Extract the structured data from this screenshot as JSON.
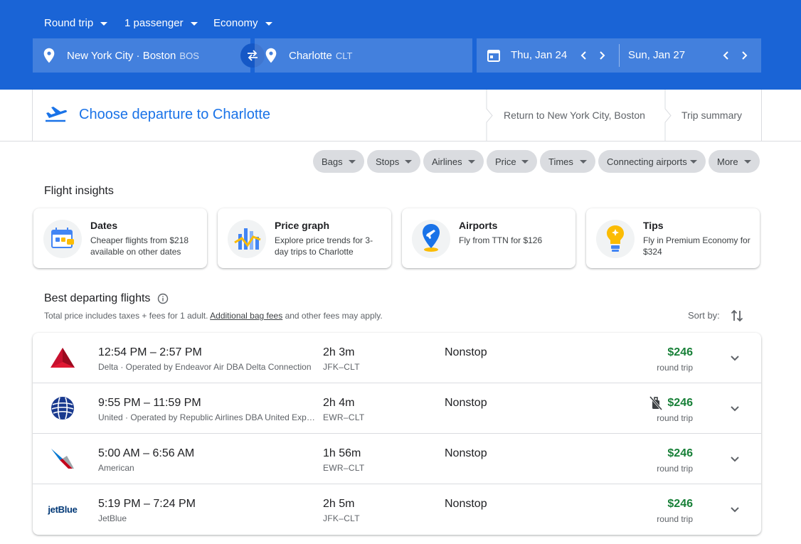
{
  "header": {
    "trip_type": "Round trip",
    "passengers": "1 passenger",
    "cabin": "Economy",
    "origin": {
      "city": "New York City · Boston",
      "code": "BOS"
    },
    "destination": {
      "city": "Charlotte",
      "code": "CLT"
    },
    "depart_date": "Thu, Jan 24",
    "return_date": "Sun, Jan 27"
  },
  "steps": {
    "current": "Choose departure to Charlotte",
    "return": "Return to New York City, Boston",
    "summary": "Trip summary"
  },
  "filters": [
    "Bags",
    "Stops",
    "Airlines",
    "Price",
    "Times",
    "Connecting airports",
    "More"
  ],
  "insights": {
    "heading": "Flight insights",
    "cards": [
      {
        "title": "Dates",
        "desc": "Cheaper flights from $218 available on other dates",
        "icon": "calendar-icon"
      },
      {
        "title": "Price graph",
        "desc": "Explore price trends for 3-day trips to Charlotte",
        "icon": "price-graph-icon"
      },
      {
        "title": "Airports",
        "desc": "Fly from TTN for $126",
        "icon": "airport-pin-icon"
      },
      {
        "title": "Tips",
        "desc": "Fly in Premium Economy for $324",
        "icon": "lightbulb-icon"
      }
    ]
  },
  "results": {
    "heading": "Best departing flights",
    "note_prefix": "Total price includes taxes + fees for 1 adult.",
    "note_link": "Additional bag fees",
    "note_suffix": "and other fees may apply.",
    "sort_label": "Sort by:"
  },
  "flights": [
    {
      "times": "12:54 PM – 2:57 PM",
      "airline": "Delta · Operated by Endeavor Air DBA Delta Connection",
      "duration": "2h 3m",
      "route": "JFK–CLT",
      "stops": "Nonstop",
      "price": "$246",
      "price_note": "round trip",
      "logo": "delta-logo"
    },
    {
      "times": "9:55 PM – 11:59 PM",
      "airline": "United · Operated by Republic Airlines DBA United Express",
      "duration": "2h 4m",
      "route": "EWR–CLT",
      "stops": "Nonstop",
      "price": "$246",
      "price_note": "round trip",
      "logo": "united-logo"
    },
    {
      "times": "5:00 AM – 6:56 AM",
      "airline": "American",
      "duration": "1h 56m",
      "route": "EWR–CLT",
      "stops": "Nonstop",
      "price": "$246",
      "price_note": "round trip",
      "logo": "american-logo"
    },
    {
      "times": "5:19 PM – 7:24 PM",
      "airline": "JetBlue",
      "duration": "2h 5m",
      "route": "JFK–CLT",
      "stops": "Nonstop",
      "price": "$246",
      "price_note": "round trip",
      "logo": "jetblue-logo",
      "logo_text": "jetBlue"
    }
  ],
  "colors": {
    "header_blue": "#1a64d6",
    "accent_blue": "#1a73e8",
    "price_green": "#188038"
  }
}
